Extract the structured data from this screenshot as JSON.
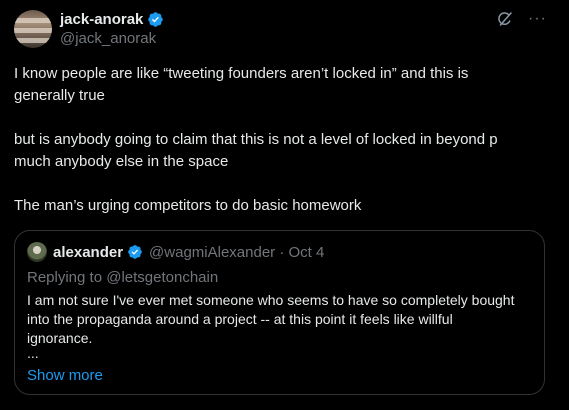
{
  "author": {
    "display_name": "jack-anorak",
    "handle": "@jack_anorak",
    "verified": true
  },
  "icons": {
    "verified": "verified-badge-icon",
    "grok": "grok-icon",
    "more": "more-icon"
  },
  "colors": {
    "background": "#000000",
    "text": "#e7e9ea",
    "secondary": "#71767b",
    "accent": "#1d9bf0",
    "border": "#2f3336"
  },
  "actions": {
    "more_label": "···"
  },
  "tweet": {
    "lines": [
      "I know people are like “tweeting founders aren’t locked in” and this is",
      "generally true",
      "but is anybody going to claim that this is not a level of locked in beyond p",
      "much anybody else in the space",
      "The man’s urging competitors to do basic homework"
    ]
  },
  "quote": {
    "display_name": "alexander",
    "handle_date": "@wagmiAlexander · Oct 4",
    "replying_to": "Replying to @letsgetonchain",
    "lines": [
      "I am not sure I've ever met someone who seems to have so completely bought",
      "into the propaganda around a project -- at this point it feels like willful",
      "ignorance."
    ],
    "ellipsis": "...",
    "show_more": "Show more"
  }
}
